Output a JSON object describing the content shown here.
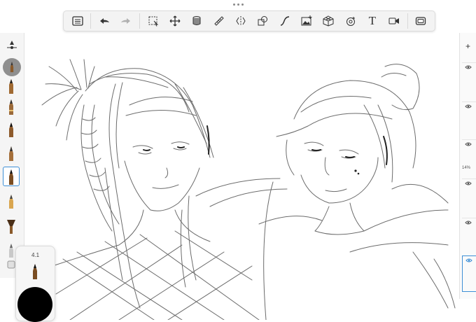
{
  "toolbar": {
    "tools": [
      {
        "name": "layers-list",
        "icon": "list-icon"
      },
      {
        "name": "undo",
        "icon": "undo-icon"
      },
      {
        "name": "redo",
        "icon": "redo-icon"
      },
      {
        "name": "select",
        "icon": "selection-icon"
      },
      {
        "name": "transform",
        "icon": "move-icon"
      },
      {
        "name": "fill",
        "icon": "bucket-icon"
      },
      {
        "name": "ruler",
        "icon": "ruler-icon"
      },
      {
        "name": "symmetry",
        "icon": "symmetry-icon"
      },
      {
        "name": "shapes",
        "icon": "shapes-icon"
      },
      {
        "name": "curve",
        "icon": "curve-icon"
      },
      {
        "name": "image",
        "icon": "image-icon"
      },
      {
        "name": "perspective",
        "icon": "perspective-icon"
      },
      {
        "name": "stamp",
        "icon": "stamp-icon"
      },
      {
        "name": "text",
        "icon": "text-icon",
        "label": "T"
      },
      {
        "name": "video",
        "icon": "video-icon"
      },
      {
        "name": "fullscreen",
        "icon": "fullscreen-icon"
      }
    ]
  },
  "brush_size": "4.1",
  "layers": {
    "opacity_label": "14%"
  },
  "colors": {
    "current": "#000000",
    "accent": "#3d8fd6"
  }
}
